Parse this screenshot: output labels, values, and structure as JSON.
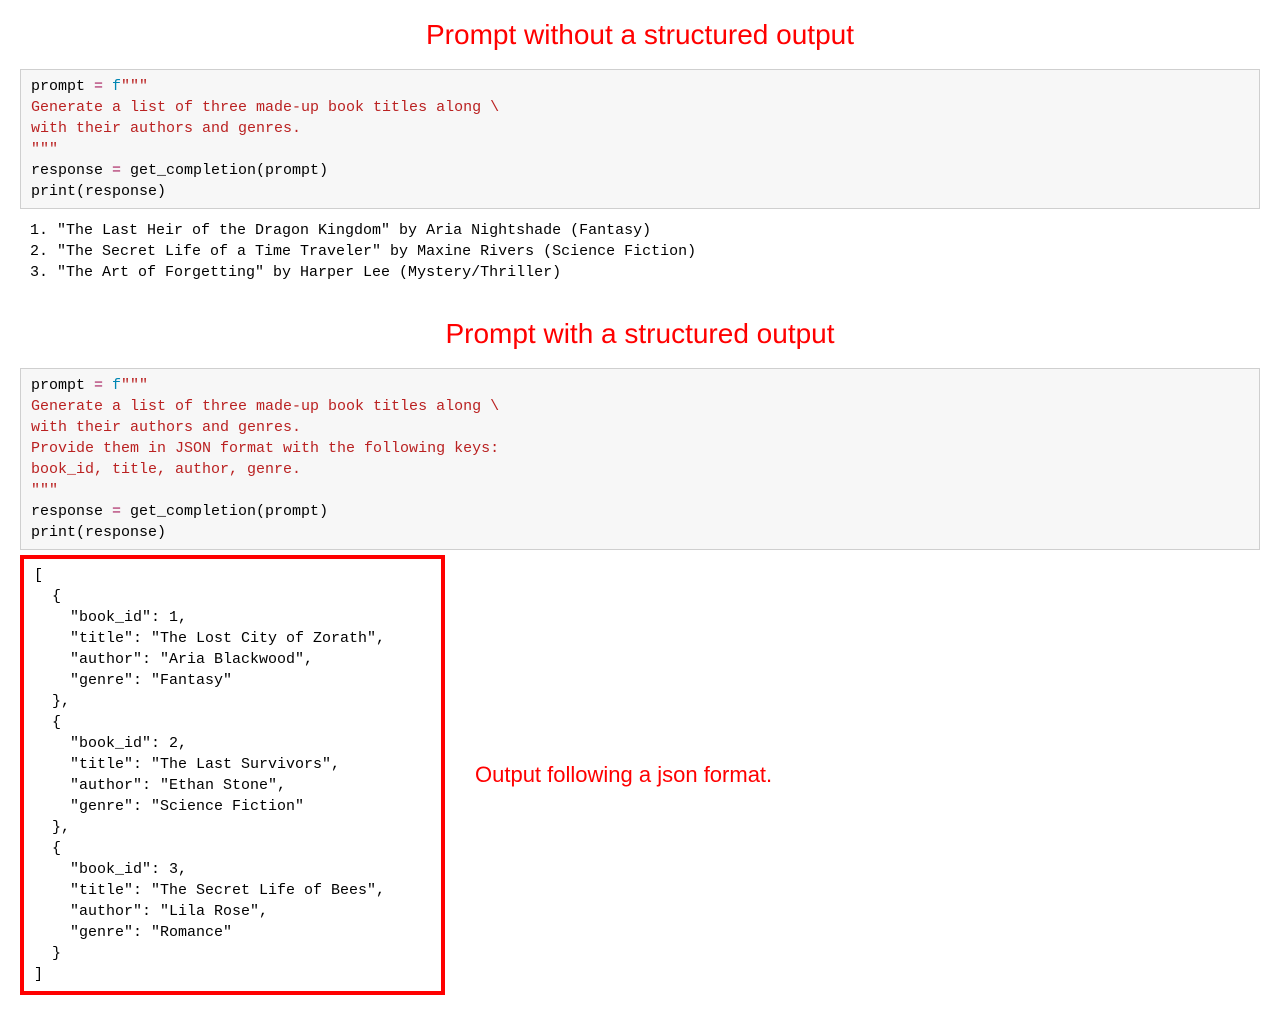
{
  "heading1": "Prompt without a structured output",
  "heading2": "Prompt with a structured output",
  "code1": {
    "line1_a": "prompt ",
    "line1_op": "=",
    "line1_fpre": " f",
    "line1_tq": "\"\"\"",
    "line2": "Generate a list of three made-up book titles along \\",
    "line3": "with their authors and genres.",
    "line4_tq": "\"\"\"",
    "line5_a": "response ",
    "line5_op": "=",
    "line5_b": " get_completion(prompt)",
    "line6": "print(response)"
  },
  "output1": "1. \"The Last Heir of the Dragon Kingdom\" by Aria Nightshade (Fantasy)\n2. \"The Secret Life of a Time Traveler\" by Maxine Rivers (Science Fiction)\n3. \"The Art of Forgetting\" by Harper Lee (Mystery/Thriller)",
  "code2": {
    "line1_a": "prompt ",
    "line1_op": "=",
    "line1_fpre": " f",
    "line1_tq": "\"\"\"",
    "line2": "Generate a list of three made-up book titles along \\",
    "line3": "with their authors and genres.",
    "line4": "Provide them in JSON format with the following keys:",
    "line5": "book_id, title, author, genre.",
    "line6_tq": "\"\"\"",
    "line7_a": "response ",
    "line7_op": "=",
    "line7_b": " get_completion(prompt)",
    "line8": "print(response)"
  },
  "output2": "[\n  {\n    \"book_id\": 1,\n    \"title\": \"The Lost City of Zorath\",\n    \"author\": \"Aria Blackwood\",\n    \"genre\": \"Fantasy\"\n  },\n  {\n    \"book_id\": 2,\n    \"title\": \"The Last Survivors\",\n    \"author\": \"Ethan Stone\",\n    \"genre\": \"Science Fiction\"\n  },\n  {\n    \"book_id\": 3,\n    \"title\": \"The Secret Life of Bees\",\n    \"author\": \"Lila Rose\",\n    \"genre\": \"Romance\"\n  }\n]",
  "annotation": "Output following a json format."
}
